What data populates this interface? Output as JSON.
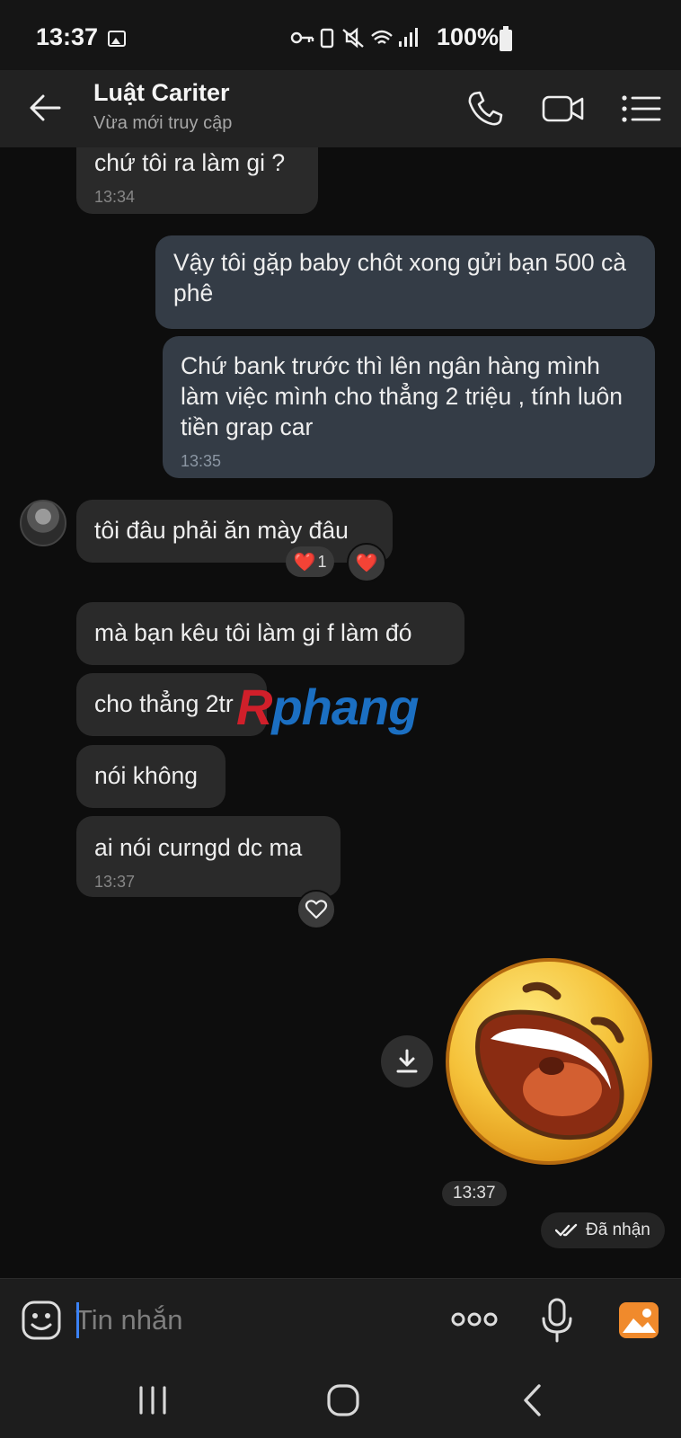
{
  "status_bar": {
    "time": "13:37",
    "battery": "100%",
    "icons": [
      "gallery-icon",
      "key-icon",
      "battery-saver-icon",
      "mute-icon",
      "wifi-icon",
      "signal-icon"
    ]
  },
  "header": {
    "contact_name": "Luật Cariter",
    "contact_status": "Vừa mới truy cập"
  },
  "messages": [
    {
      "direction": "in",
      "text": "chứ tôi ra làm gi ?",
      "time": "13:34"
    },
    {
      "direction": "out",
      "text": "Vậy tôi gặp baby chôt xong gửi bạn 500 cà phê",
      "time": ""
    },
    {
      "direction": "out",
      "text": "Chứ bank trước thì lên ngân hàng mình làm việc mình cho thẳng 2 triệu , tính luôn tiền grap car",
      "time": "13:35"
    },
    {
      "direction": "in",
      "text": "tôi đâu phải ăn mày đâu",
      "time": "",
      "reaction": {
        "emoji": "❤️",
        "count": "1"
      }
    },
    {
      "direction": "in",
      "text": "mà bạn kêu tôi làm gi f làm đó",
      "time": ""
    },
    {
      "direction": "in",
      "text": "cho thẳng 2tr",
      "time": ""
    },
    {
      "direction": "in",
      "text": "nói không",
      "time": ""
    },
    {
      "direction": "in",
      "text": "ai nói curngd dc ma",
      "time": "13:37"
    }
  ],
  "reaction_heart": "❤️",
  "watermark": {
    "first": "R",
    "rest": "phang"
  },
  "sticker": {
    "type": "laughing-face-sticker",
    "time": "13:37"
  },
  "delivery_status": "Đã nhận",
  "input": {
    "placeholder": "Tin nhắn",
    "value": ""
  },
  "colors": {
    "background": "#0d0d0d",
    "incoming_bubble": "#2a2a2a",
    "outgoing_bubble": "#343c46",
    "header": "#222222",
    "accent_caret": "#3b82f6",
    "gallery_icon": "#f08a2c"
  }
}
